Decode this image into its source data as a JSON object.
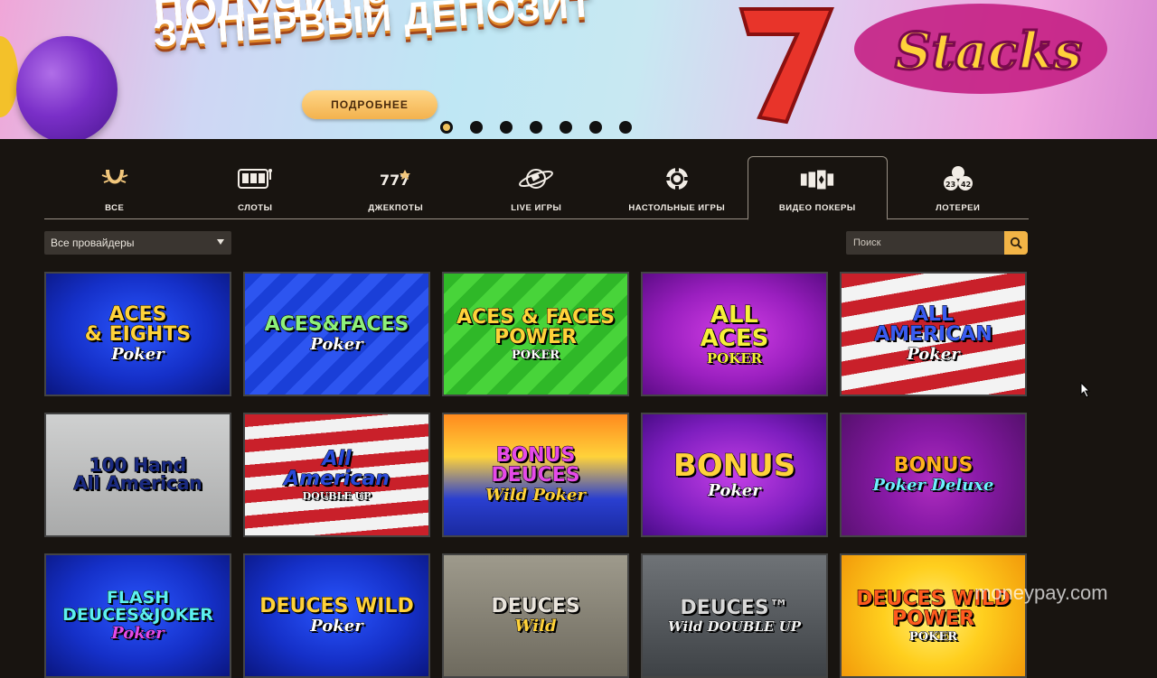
{
  "banner": {
    "headline_top": "ПОЛУЧИТЕ",
    "headline": "ЗА ПЕРВЫЙ ДЕПОЗИТ",
    "more_button": "ПОДРОБНЕЕ",
    "logo_text": "Stacks",
    "slides": 7,
    "active_slide": 1
  },
  "tabs": [
    {
      "label": "ВСЕ",
      "icon": "horseshoe-icon"
    },
    {
      "label": "СЛОТЫ",
      "icon": "slot-machine-icon"
    },
    {
      "label": "ДЖЕКПОТЫ",
      "icon": "lucky-sevens-icon"
    },
    {
      "label": "LIVE ИГРЫ",
      "icon": "globe-icon"
    },
    {
      "label": "НАСТОЛЬНЫЕ ИГРЫ",
      "icon": "chip-icon"
    },
    {
      "label": "ВИДЕО ПОКЕРЫ",
      "icon": "cards-icon",
      "active": true
    },
    {
      "label": "ЛОТЕРЕИ",
      "icon": "lottery-balls-icon"
    }
  ],
  "lottery_icon_numbers": [
    "23",
    "42"
  ],
  "filters": {
    "provider_selected": "Все провайдеры",
    "search_placeholder": "Поиск"
  },
  "games": [
    {
      "title": "ACES\n& EIGHTS",
      "sub": "Poker"
    },
    {
      "title": "ACES&FACES",
      "sub": "Poker"
    },
    {
      "title": "ACES & FACES\nPOWER",
      "sub": "POKER"
    },
    {
      "title": "ALL\nACES",
      "sub": "POKER"
    },
    {
      "title": "ALL\nAMERICAN",
      "sub": "Poker"
    },
    {
      "title": "100 Hand\nAll American",
      "sub": ""
    },
    {
      "title": "All\nAmerican",
      "sub": "DOUBLE UP"
    },
    {
      "title": "BONUS\nDEUCES",
      "sub": "Wild Poker"
    },
    {
      "title": "BONUS",
      "sub": "Poker"
    },
    {
      "title": "BONUS",
      "sub": "Poker Deluxe"
    },
    {
      "title": "FLASH\nDEUCES&JOKER",
      "sub": "Poker"
    },
    {
      "title": "DEUCES WILD",
      "sub": "Poker"
    },
    {
      "title": "DEUCES",
      "sub": "Wild"
    },
    {
      "title": "DEUCES™",
      "sub": "Wild DOUBLE UP"
    },
    {
      "title": "DEUCES WILD\nPOWER",
      "sub": "POKER"
    }
  ],
  "watermark": "moneypay.com",
  "colors": {
    "accent": "#f2b446",
    "background": "#181410",
    "tab_text": "#f2ede6"
  }
}
